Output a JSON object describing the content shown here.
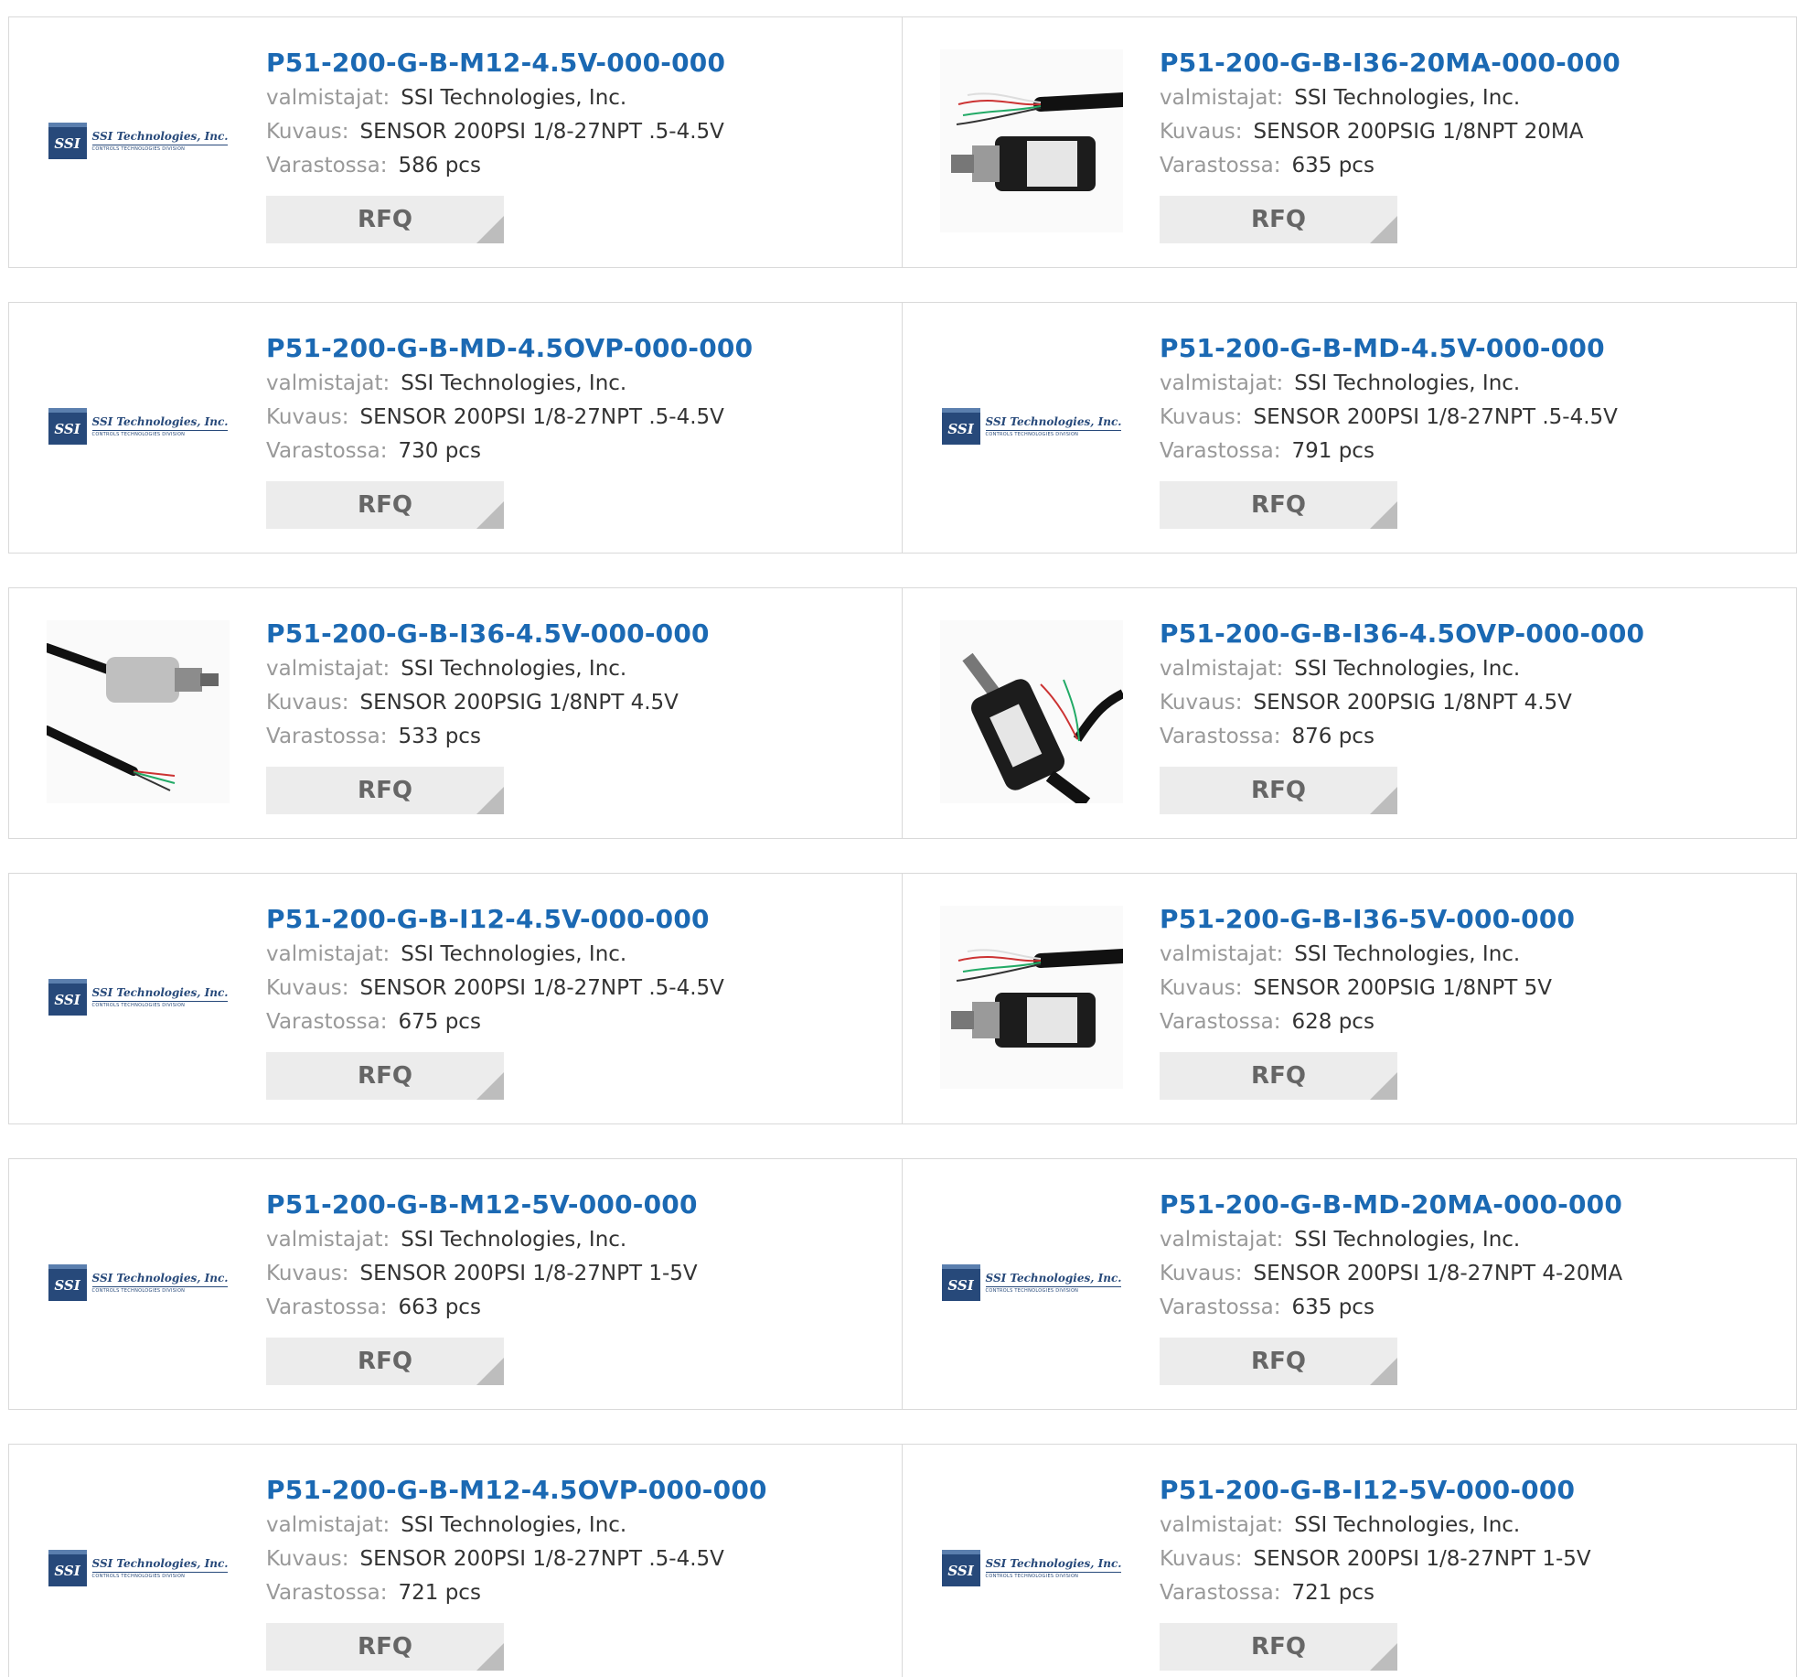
{
  "labels": {
    "manufacturer": "valmistajat:",
    "description": "Kuvaus:",
    "stock": "Varastossa:",
    "rfq": "RFQ"
  },
  "logo": {
    "mark": "SSI",
    "name": "SSI Technologies, Inc.",
    "division": "CONTROLS TECHNOLOGIES DIVISION"
  },
  "colors": {
    "link": "#1b69b3",
    "label": "#999999",
    "button_bg": "#ececec",
    "border": "#d9d9d9"
  },
  "products": [
    {
      "part": "P51-200-G-B-M12-4.5V-000-000",
      "manufacturer": "SSI Technologies, Inc.",
      "description": "SENSOR 200PSI 1/8-27NPT .5-4.5V",
      "stock": "586 pcs",
      "image": "ssi-logo"
    },
    {
      "part": "P51-200-G-B-I36-20MA-000-000",
      "manufacturer": "SSI Technologies, Inc.",
      "description": "SENSOR 200PSIG 1/8NPT 20MA",
      "stock": "635 pcs",
      "image": "sensor-horizontal-photo"
    },
    {
      "part": "P51-200-G-B-MD-4.5OVP-000-000",
      "manufacturer": "SSI Technologies, Inc.",
      "description": "SENSOR 200PSI 1/8-27NPT .5-4.5V",
      "stock": "730 pcs",
      "image": "ssi-logo"
    },
    {
      "part": "P51-200-G-B-MD-4.5V-000-000",
      "manufacturer": "SSI Technologies, Inc.",
      "description": "SENSOR 200PSI 1/8-27NPT .5-4.5V",
      "stock": "791 pcs",
      "image": "ssi-logo"
    },
    {
      "part": "P51-200-G-B-I36-4.5V-000-000",
      "manufacturer": "SSI Technologies, Inc.",
      "description": "SENSOR 200PSIG 1/8NPT 4.5V",
      "stock": "533 pcs",
      "image": "sensor-cable-photo"
    },
    {
      "part": "P51-200-G-B-I36-4.5OVP-000-000",
      "manufacturer": "SSI Technologies, Inc.",
      "description": "SENSOR 200PSIG 1/8NPT 4.5V",
      "stock": "876 pcs",
      "image": "sensor-diagonal-photo"
    },
    {
      "part": "P51-200-G-B-I12-4.5V-000-000",
      "manufacturer": "SSI Technologies, Inc.",
      "description": "SENSOR 200PSI 1/8-27NPT .5-4.5V",
      "stock": "675 pcs",
      "image": "ssi-logo"
    },
    {
      "part": "P51-200-G-B-I36-5V-000-000",
      "manufacturer": "SSI Technologies, Inc.",
      "description": "SENSOR 200PSIG 1/8NPT 5V",
      "stock": "628 pcs",
      "image": "sensor-horizontal-photo"
    },
    {
      "part": "P51-200-G-B-M12-5V-000-000",
      "manufacturer": "SSI Technologies, Inc.",
      "description": "SENSOR 200PSI 1/8-27NPT 1-5V",
      "stock": "663 pcs",
      "image": "ssi-logo"
    },
    {
      "part": "P51-200-G-B-MD-20MA-000-000",
      "manufacturer": "SSI Technologies, Inc.",
      "description": "SENSOR 200PSI 1/8-27NPT 4-20MA",
      "stock": "635 pcs",
      "image": "ssi-logo"
    },
    {
      "part": "P51-200-G-B-M12-4.5OVP-000-000",
      "manufacturer": "SSI Technologies, Inc.",
      "description": "SENSOR 200PSI 1/8-27NPT .5-4.5V",
      "stock": "721 pcs",
      "image": "ssi-logo"
    },
    {
      "part": "P51-200-G-B-I12-5V-000-000",
      "manufacturer": "SSI Technologies, Inc.",
      "description": "SENSOR 200PSI 1/8-27NPT 1-5V",
      "stock": "721 pcs",
      "image": "ssi-logo"
    }
  ]
}
